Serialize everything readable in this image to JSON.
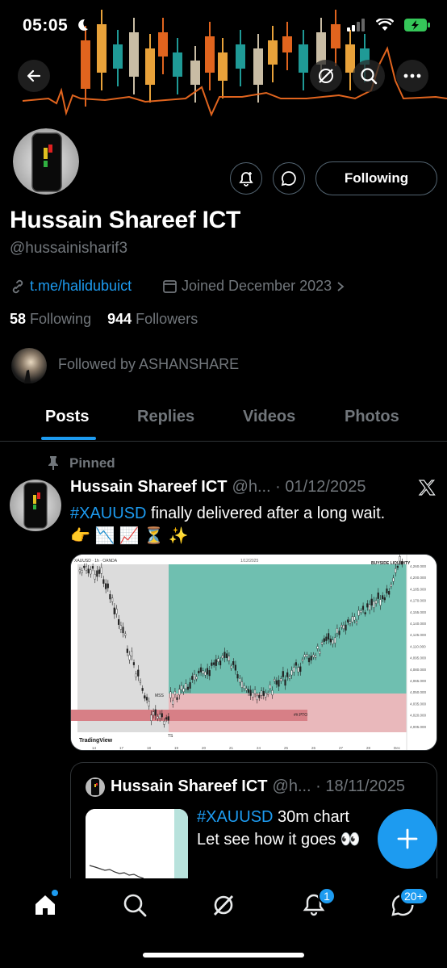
{
  "status_bar": {
    "time": "05:05"
  },
  "profile": {
    "name": "Hussain Shareef ICT",
    "handle": "@hussainisharif3",
    "link": "t.me/halidubuict",
    "joined": "Joined December 2023",
    "following_count": "58",
    "following_label": "Following",
    "followers_count": "944",
    "followers_label": "Followers",
    "followed_by": "Followed by ASHANSHARE",
    "following_button": "Following"
  },
  "tabs": [
    "Posts",
    "Replies",
    "Videos",
    "Photos"
  ],
  "pinned_label": "Pinned",
  "post": {
    "author": "Hussain Shareef ICT",
    "handle_date": "@h... · 01/12/2025",
    "hashtag": "#XAUUSD",
    "text": " finally delivered after a long wait.",
    "emoji_line": "👉 📉 📈 ⏳ ✨",
    "chart": {
      "header": "XAUUSD · 1h · OANDA",
      "center_label": "1/12/2025",
      "top_right_label": "BUYSIDE LIQUIDITY",
      "mss_label": "MSS",
      "ts_label": "TS",
      "sl_label": "##.PTO",
      "watermark": "TradingView",
      "price_labels": [
        "4,260.000",
        "4,200.000",
        "4,185.000",
        "4,170.000",
        "4,155.000",
        "4,140.000",
        "4,125.000",
        "4,110.000",
        "4,095.000",
        "4,080.000",
        "4,065.000",
        "4,050.000",
        "4,035.000",
        "4,020.000",
        "4,005.000"
      ],
      "date_labels": [
        "14",
        "17",
        "18",
        "19",
        "20",
        "21",
        "24",
        "25",
        "26",
        "27",
        "28",
        "Dec"
      ]
    }
  },
  "quote": {
    "author": "Hussain Shareef ICT",
    "handle_date": "@h... · 18/11/2025",
    "hashtag": "#XAUUSD",
    "line1": " 30m chart",
    "line2": "Let see how it goes 👀"
  },
  "nav": {
    "notif_badge": "1",
    "messages_badge": "20+"
  },
  "colors": {
    "accent": "#1d9bf0",
    "muted": "#71767b",
    "border": "#2f3336"
  }
}
